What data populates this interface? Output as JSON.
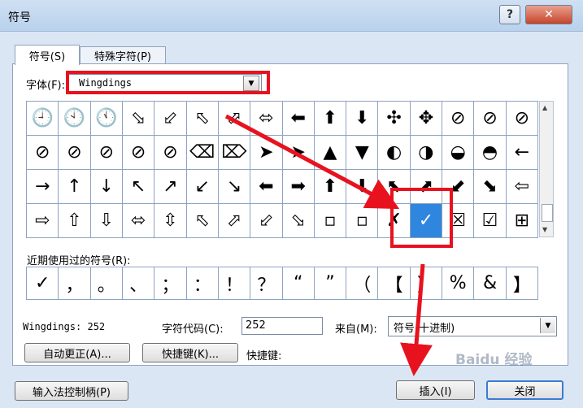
{
  "window": {
    "title": "符号",
    "help_label": "?",
    "close_label": "✕"
  },
  "tabs": [
    {
      "label": "符号(S)",
      "active": true
    },
    {
      "label": "特殊字符(P)",
      "active": false
    }
  ],
  "font": {
    "label": "字体(F):",
    "value": "Wingdings"
  },
  "symbol_grid": [
    [
      "🕘",
      "🕙",
      "🕚",
      "⬂",
      "⬃",
      "⬁",
      "⬀",
      "⬄",
      "⬅",
      "⬆",
      "⬇",
      "✣",
      "✥",
      "⊘",
      "⊘",
      "⊘"
    ],
    [
      "⊘",
      "⊘",
      "⊘",
      "⊘",
      "⊘",
      "⌫",
      "⌦",
      "➤",
      "➤",
      "▲",
      "▼",
      "◐",
      "◑",
      "◒",
      "◓",
      "←"
    ],
    [
      "→",
      "↑",
      "↓",
      "↖",
      "↗",
      "↙",
      "↘",
      "⬅",
      "➡",
      "⬆",
      "⬇",
      "⬉",
      "⬈",
      "⬋",
      "⬊",
      "⇦"
    ],
    [
      "⇨",
      "⇧",
      "⇩",
      "⬄",
      "⇳",
      "⬁",
      "⬀",
      "⬃",
      "⬂",
      "▫",
      "▫",
      "✗",
      "✓",
      "☒",
      "☑",
      "⊞"
    ]
  ],
  "selected_cell": {
    "row": 3,
    "col": 12
  },
  "recent": {
    "label": "近期使用过的符号(R):",
    "symbols": [
      "✓",
      "，",
      "。",
      "、",
      "；",
      "：",
      "！",
      "？",
      "“",
      "”",
      "（",
      "【",
      "）",
      "%",
      "&",
      "】"
    ]
  },
  "info": {
    "font_char": "Wingdings: 252",
    "charcode_label": "字符代码(C):",
    "charcode_value": "252",
    "from_label": "来自(M):",
    "from_value": "符号(十进制)"
  },
  "buttons": {
    "autocorrect": "自动更正(A)...",
    "shortcut_key": "快捷键(K)...",
    "shortcut_text": "快捷键:",
    "ime": "输入法控制柄(P)",
    "insert": "插入(I)",
    "cancel": "关闭"
  },
  "watermark": "Baidu 经验",
  "colors": {
    "annotation_red": "#e8121f",
    "selection_blue": "#2e86de"
  }
}
